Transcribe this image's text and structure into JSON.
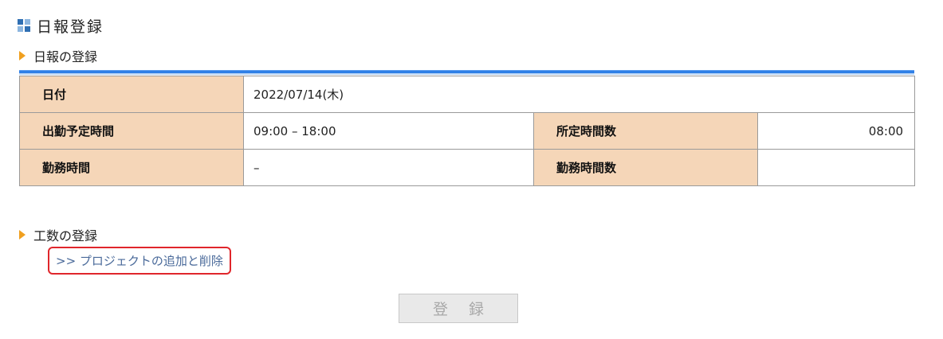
{
  "header": {
    "title": "日報登録",
    "icon": "grid-icon"
  },
  "sections": {
    "daily_report": "日報の登録",
    "effort": "工数の登録"
  },
  "form": {
    "date_label": "日付",
    "date_value": "2022/07/14(木)",
    "scheduled_time_label": "出勤予定時間",
    "scheduled_time_value": "09:00 – 18:00",
    "prescribed_hours_label": "所定時間数",
    "prescribed_hours_value": "08:00",
    "work_time_label": "勤務時間",
    "work_time_value": "–",
    "work_hours_label": "勤務時間数",
    "work_hours_value": ""
  },
  "links": {
    "add_remove_project": ">> プロジェクトの追加と削除"
  },
  "buttons": {
    "register": "登 録"
  },
  "colors": {
    "label_bg": "#f5d6b8",
    "accent_bar": "#2f7fe6",
    "heading_marker": "#f0a020",
    "highlight_border": "#e0262b"
  }
}
